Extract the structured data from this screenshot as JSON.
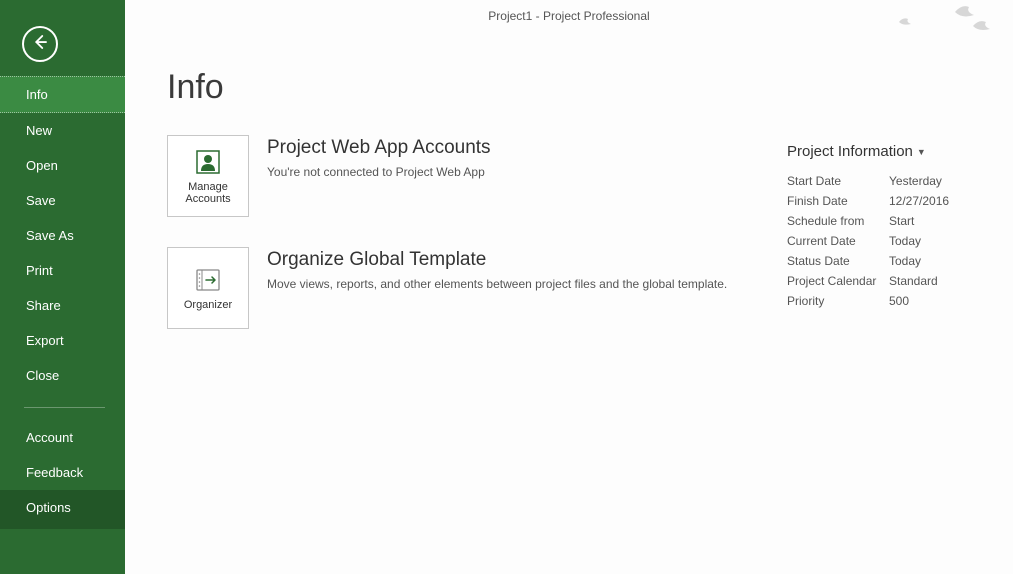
{
  "titlebar": {
    "text": "Project1  -  Project Professional"
  },
  "page": {
    "title": "Info"
  },
  "sidebar": {
    "items": [
      {
        "label": "Info",
        "selected": true
      },
      {
        "label": "New"
      },
      {
        "label": "Open"
      },
      {
        "label": "Save"
      },
      {
        "label": "Save As"
      },
      {
        "label": "Print"
      },
      {
        "label": "Share"
      },
      {
        "label": "Export"
      },
      {
        "label": "Close"
      }
    ],
    "footer_items": [
      {
        "label": "Account"
      },
      {
        "label": "Feedback"
      },
      {
        "label": "Options"
      }
    ]
  },
  "sections": [
    {
      "button_label": "Manage Accounts",
      "heading": "Project Web App Accounts",
      "desc": "You're not connected to Project Web App"
    },
    {
      "button_label": "Organizer",
      "heading": "Organize Global Template",
      "desc": "Move views, reports, and other elements between project files and the global template."
    }
  ],
  "project_info": {
    "heading": "Project Information",
    "rows": [
      {
        "label": "Start Date",
        "value": "Yesterday"
      },
      {
        "label": "Finish Date",
        "value": "12/27/2016"
      },
      {
        "label": "Schedule from",
        "value": "Start"
      },
      {
        "label": "Current Date",
        "value": "Today"
      },
      {
        "label": "Status Date",
        "value": "Today"
      },
      {
        "label": "Project Calendar",
        "value": "Standard"
      },
      {
        "label": "Priority",
        "value": "500"
      }
    ]
  }
}
